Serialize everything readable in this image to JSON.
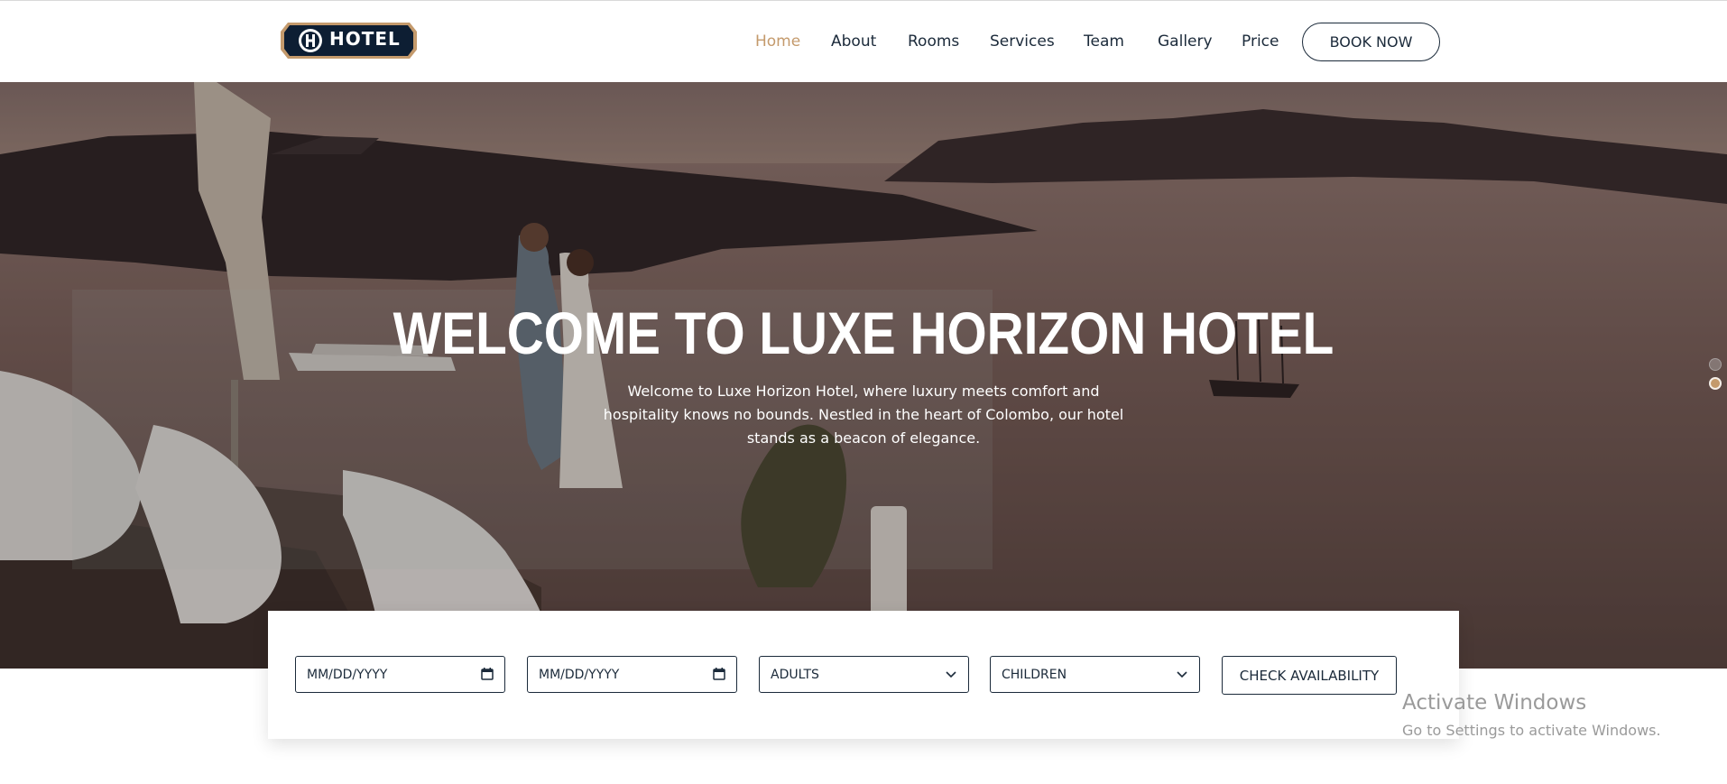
{
  "header": {
    "logo_text": "HOTEL",
    "nav": [
      {
        "label": "Home",
        "active": true
      },
      {
        "label": "About",
        "active": false
      },
      {
        "label": "Rooms",
        "active": false
      },
      {
        "label": "Services",
        "active": false
      },
      {
        "label": "Team",
        "active": false
      },
      {
        "label": "Gallery",
        "active": false
      },
      {
        "label": "Price",
        "active": false
      }
    ],
    "book_now_label": "BOOK NOW"
  },
  "hero": {
    "title": "WELCOME TO LUXE HORIZON HOTEL",
    "subtitle": "Welcome to Luxe Horizon Hotel, where luxury meets comfort and hospitality knows no bounds. Nestled in the heart of Colombo, our hotel stands as a beacon of elegance.",
    "slide_count": 2,
    "active_slide": 2
  },
  "booking": {
    "checkin_placeholder": "MM/DD/YYYY",
    "checkout_placeholder": "MM/DD/YYYY",
    "adults_label": "ADULTS",
    "children_label": "CHILDREN",
    "check_availability_label": "CHECK AVAILABILITY"
  },
  "watermark": {
    "title": "Activate Windows",
    "subtitle": "Go to Settings to activate Windows."
  },
  "colors": {
    "accent": "#c49a6c",
    "navy": "#1b2a3a"
  }
}
